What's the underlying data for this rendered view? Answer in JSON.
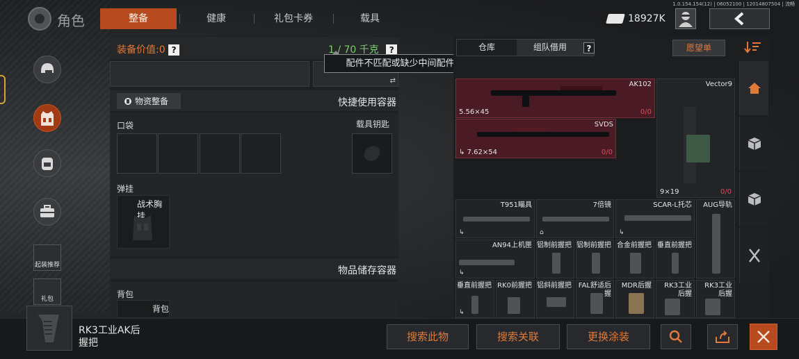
{
  "header": {
    "title": "角色",
    "tabs": [
      {
        "label": "整备",
        "active": true
      },
      {
        "label": "健康"
      },
      {
        "label": "礼包卡券"
      },
      {
        "label": "载具"
      }
    ],
    "currency": "18927K",
    "version": "1.0.154.154(12) | 06052100 | 12014807504 | 流畅"
  },
  "sidebar": {
    "icons": [
      "helmet-icon",
      "vest-icon",
      "backpack-icon",
      "case-icon"
    ],
    "loadout_label": "起装推荐",
    "gift_label": "礼包"
  },
  "equipment": {
    "value_label": "装备价值:",
    "value": "0",
    "weight": "1 / 70 千克",
    "tooltip": "配件不匹配或缺少中间配件",
    "supply_button": "物资整备",
    "quick_container_title": "快捷使用容器",
    "pocket_label": "口袋",
    "vehicle_key_label": "载具钥匙",
    "chest_rig_label": "弹挂",
    "chest_rig_item": "战术胸挂",
    "storage_container_title": "物品储存容器",
    "backpack_label": "背包",
    "backpack_item": "背包"
  },
  "warehouse": {
    "tabs": [
      "仓库",
      "组队借用"
    ],
    "wishlist": "愿望单",
    "big_items": [
      {
        "name": "AK102",
        "caliber": "5.56×45",
        "count": "0/0"
      },
      {
        "name": "SVDS",
        "caliber": "7.62×54",
        "count": "0/0"
      },
      {
        "name": "Vector9",
        "caliber": "9×19",
        "count": "0/0"
      }
    ],
    "row1": [
      "T951瞄具",
      "7倍镜",
      "SCAR-L托芯",
      "AUG导轨"
    ],
    "row2": [
      "AN94上机匣",
      "铝制前握把",
      "铝制前握把",
      "合金前握把",
      "垂直前握把"
    ],
    "row3": [
      "垂直前握把",
      "RK0前握把",
      "铝斜前握把",
      "FAL舒适后握",
      "MDR后握",
      "RK3工业后握",
      "RK3工业后握"
    ]
  },
  "selected_item": {
    "line1": "RK3工业AK后",
    "line2": "握把"
  },
  "actions": {
    "search_this": "搜索此物",
    "search_related": "搜索关联",
    "change_skin": "更换涂装"
  },
  "colors": {
    "accent": "#b84a20",
    "orange_text": "#e07a3a",
    "weight_green": "#77d06a",
    "count_red": "#e04a5a",
    "highlight_item": "#4a1b24"
  }
}
